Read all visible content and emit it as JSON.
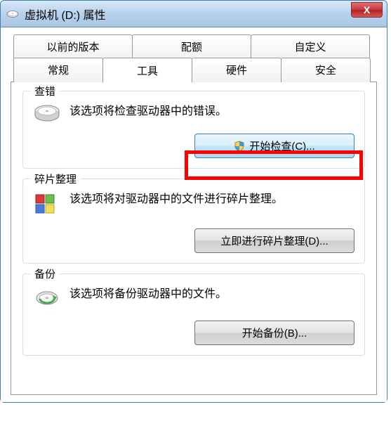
{
  "window": {
    "title": "虚拟机 (D:) 属性"
  },
  "tabs_top": {
    "prev": "以前的版本",
    "quota": "配额",
    "custom": "自定义"
  },
  "tabs_bottom": {
    "general": "常规",
    "tools": "工具",
    "hardware": "硬件",
    "security": "安全"
  },
  "groups": {
    "check": {
      "title": "查错",
      "desc": "该选项将检查驱动器中的错误。",
      "button": "开始检查(C)..."
    },
    "defrag": {
      "title": "碎片整理",
      "desc": "该选项将对驱动器中的文件进行碎片整理。",
      "button": "立即进行碎片整理(D)..."
    },
    "backup": {
      "title": "备份",
      "desc": "该选项将备份驱动器中的文件。",
      "button": "开始备份(B)..."
    }
  }
}
